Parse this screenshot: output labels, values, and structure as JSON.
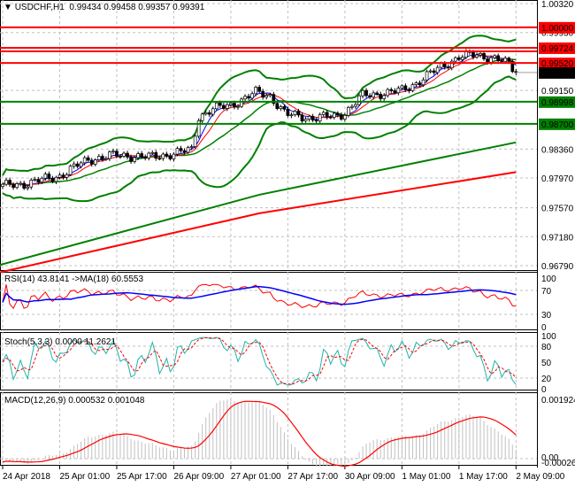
{
  "header": {
    "symbol": "USDCHF,H1",
    "ohlc": "0.99434 0.99458 0.99357 0.99391"
  },
  "indicators": {
    "rsi_label": "RSI(14) 43.8141  ->MA(18) 60.5553",
    "stoch_label": "Stoch(5,3,3) 0.0000 11.2621",
    "macd_label": "MACD(12,26,9) 0.000532 0.001048"
  },
  "chart_data": {
    "type": "candlestick",
    "symbol": "USDCHF",
    "timeframe": "H1",
    "price_ticks": [
      "1.00320",
      "0.99930",
      "0.99150",
      "0.98360",
      "0.97970",
      "0.97570",
      "0.97180",
      "0.96790"
    ],
    "ylim": [
      0.9679,
      1.0032
    ],
    "time_labels": [
      "24 Apr 2018",
      "25 Apr 01:00",
      "25 Apr 17:00",
      "26 Apr 09:00",
      "27 Apr 01:00",
      "27 Apr 17:00",
      "30 Apr 09:00",
      "1 May 01:00",
      "1 May 17:00",
      "2 May 09:00"
    ],
    "close_keypoints": [
      [
        "24 Apr 09:00",
        0.9786
      ],
      [
        "24 Apr 16:00",
        0.979
      ],
      [
        "25 Apr 01:00",
        0.98
      ],
      [
        "25 Apr 09:00",
        0.9822
      ],
      [
        "25 Apr 17:00",
        0.9828
      ],
      [
        "26 Apr 02:00",
        0.9825
      ],
      [
        "26 Apr 09:00",
        0.983
      ],
      [
        "26 Apr 14:00",
        0.9835
      ],
      [
        "26 Apr 16:00",
        0.988
      ],
      [
        "26 Apr 20:00",
        0.989
      ],
      [
        "27 Apr 01:00",
        0.9895
      ],
      [
        "27 Apr 08:00",
        0.9912
      ],
      [
        "27 Apr 12:00",
        0.9908
      ],
      [
        "27 Apr 16:00",
        0.9885
      ],
      [
        "27 Apr 17:00",
        0.9882
      ],
      [
        "30 Apr 00:00",
        0.9878
      ],
      [
        "30 Apr 06:00",
        0.988
      ],
      [
        "30 Apr 09:00",
        0.9885
      ],
      [
        "30 Apr 14:00",
        0.9908
      ],
      [
        "30 Apr 21:00",
        0.9912
      ],
      [
        "1 May 01:00",
        0.9915
      ],
      [
        "1 May 05:00",
        0.9925
      ],
      [
        "1 May 12:00",
        0.9947
      ],
      [
        "1 May 17:00",
        0.996
      ],
      [
        "1 May 22:00",
        0.9963
      ],
      [
        "2 May 03:00",
        0.9958
      ],
      [
        "2 May 07:00",
        0.995
      ],
      [
        "2 May 09:00",
        0.99391
      ]
    ],
    "long_ma_green": [
      [
        "24 Apr 09:00",
        0.968
      ],
      [
        "2 May 09:00",
        0.9845
      ]
    ],
    "long_ma_red": [
      [
        "24 Apr 09:00",
        0.967
      ],
      [
        "2 May 09:00",
        0.9805
      ]
    ],
    "levels": [
      {
        "price": "1.00000",
        "color": "#ff0000"
      },
      {
        "price": "0.99724",
        "color": "#ff0000"
      },
      {
        "price": "0.99520",
        "color": "#ff0000"
      },
      {
        "price": "0.98998",
        "color": "#008000"
      },
      {
        "price": "0.98700",
        "color": "#008000"
      }
    ],
    "current_price": "0.99391",
    "rsi_ticks": [
      "100",
      "70",
      "30",
      "0"
    ],
    "stoch_ticks": [
      "100",
      "80",
      "50",
      "20",
      "0"
    ],
    "macd_ticks": [
      "0.001924",
      "0.00",
      "-0.000264"
    ],
    "colors": {
      "bollinger": "#008000",
      "rsi": "#ff0000",
      "rsi_ma": "#0000ff",
      "stoch_main": "#20b2aa",
      "stoch_signal": "#ff0000",
      "macd_hist": "#c0c0c0",
      "macd_signal": "#ff0000"
    }
  }
}
